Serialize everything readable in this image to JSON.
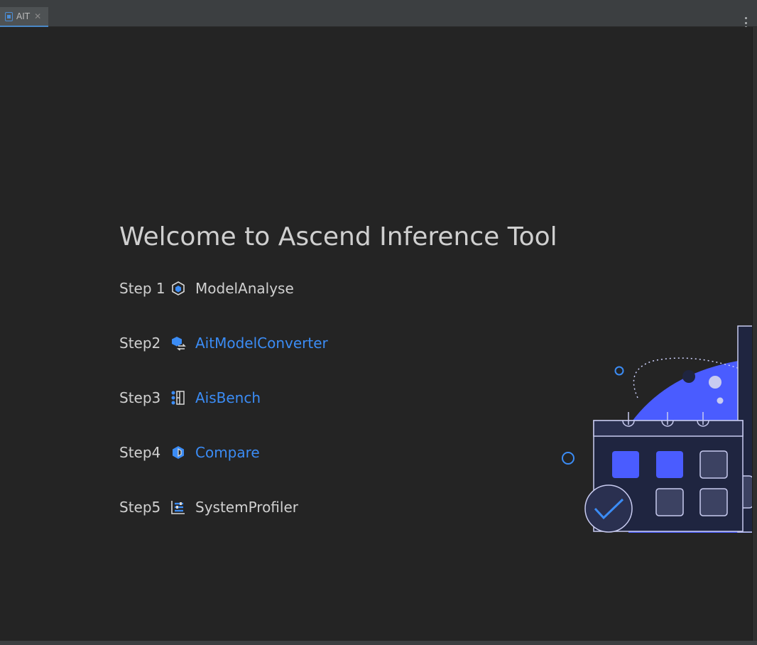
{
  "tab": {
    "label": "AIT",
    "close": "✕"
  },
  "welcome": {
    "title": "Welcome to Ascend Inference Tool",
    "steps": [
      {
        "number": "Step 1",
        "label": "ModelAnalyse",
        "icon": "model-analyse-icon",
        "link": false
      },
      {
        "number": "Step2",
        "label": "AitModelConverter",
        "icon": "model-converter-icon",
        "link": true
      },
      {
        "number": "Step3",
        "label": "AisBench",
        "icon": "aisbench-icon",
        "link": true
      },
      {
        "number": "Step4",
        "label": "Compare",
        "icon": "compare-icon",
        "link": true
      },
      {
        "number": "Step5",
        "label": "SystemProfiler",
        "icon": "system-profiler-icon",
        "link": false
      }
    ]
  },
  "colors": {
    "background": "#242424",
    "link": "#3b8cf5",
    "text": "#d0d0d0",
    "accent": "#4a5cff"
  }
}
